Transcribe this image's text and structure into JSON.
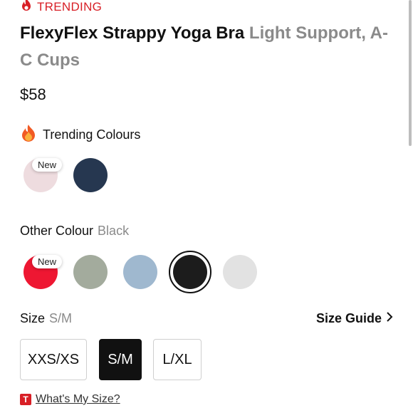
{
  "trending_label": "TRENDING",
  "product": {
    "name": "FlexyFlex Strappy Yoga Bra",
    "subtitle": "Light Support, A-C Cups",
    "price": "$58"
  },
  "trending_colours": {
    "label": "Trending Colours",
    "swatches": [
      {
        "color": "#eedcdf",
        "badge": "New"
      },
      {
        "color": "#263750",
        "badge": ""
      }
    ]
  },
  "other_colour": {
    "label": "Other Colour",
    "selected": "Black",
    "swatches": [
      {
        "color": "#ee1732",
        "badge": "New"
      },
      {
        "color": "#a3ab9d"
      },
      {
        "color": "#9fb8cf"
      },
      {
        "color": "#1c1c1c",
        "selected": true
      },
      {
        "color": "#e2e2e2"
      }
    ]
  },
  "size": {
    "label": "Size",
    "selected": "S/M",
    "guide_label": "Size Guide",
    "options": [
      "XXS/XS",
      "S/M",
      "L/XL"
    ]
  },
  "whats_my_size": "What's My Size?",
  "icons": {
    "flame": "flame-icon",
    "fire_emoji": "fire-emoji-icon",
    "chevron": "chevron-right-icon",
    "t_logo": "t-logo-icon"
  }
}
